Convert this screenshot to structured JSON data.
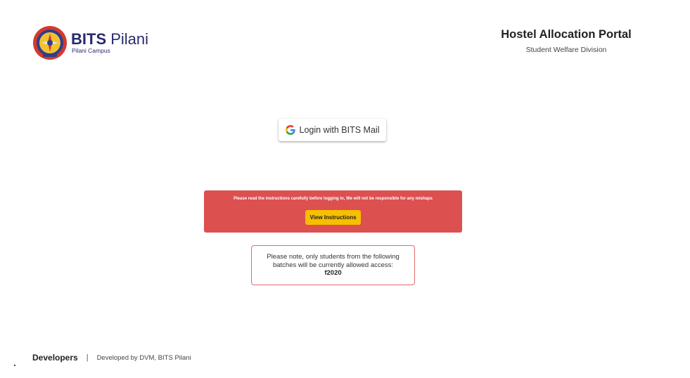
{
  "header": {
    "logo": {
      "brand_bold": "BITS",
      "brand_rest": " Pilani",
      "campus": "Pilani Campus",
      "emblem_icon": "bits-emblem-icon"
    },
    "title": "Hostel Allocation Portal",
    "subtitle": "Student Welfare Division"
  },
  "login": {
    "icon": "google-g-icon",
    "label": "Login with BITS Mail"
  },
  "alert": {
    "message": "Please read the instructions carefully before logging in, We will not be responsible for any mishaps",
    "button_label": "View Instructions",
    "background_color": "#dc5050",
    "button_color": "#f6c000"
  },
  "note": {
    "line1": "Please note, only students from the following",
    "line2": "batches will be currently allowed access:",
    "batch": "f2020",
    "border_color": "#e36a6a"
  },
  "footer": {
    "developers_link": "Developers",
    "separator": "|",
    "credit": "Developed by DVM, BITS Pilani"
  }
}
